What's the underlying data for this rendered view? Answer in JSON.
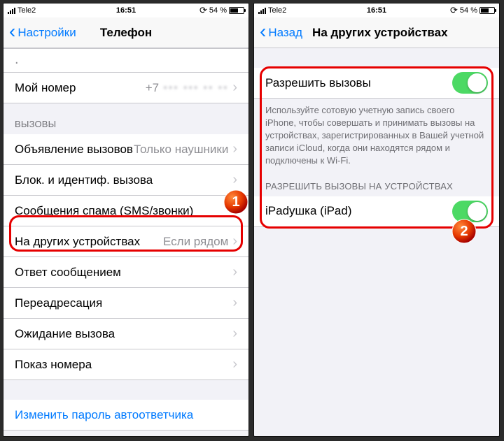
{
  "status": {
    "carrier": "Tele2",
    "time": "16:51",
    "battery_pct": "54 %"
  },
  "left": {
    "back": "Настройки",
    "title": "Телефон",
    "my_number_label": "Мой номер",
    "my_number_value": "+7",
    "section_calls": "ВЫЗОВЫ",
    "announce_label": "Объявление вызовов",
    "announce_detail": "Только наушники",
    "block_label": "Блок. и идентиф. вызова",
    "spam_label": "Сообщения спама (SMS/звонки)",
    "other_devices_label": "На других устройствах",
    "other_devices_detail": "Если рядом",
    "reply_msg_label": "Ответ сообщением",
    "forward_label": "Переадресация",
    "call_waiting_label": "Ожидание вызова",
    "caller_id_label": "Показ номера",
    "vm_password_label": "Изменить пароль автоответчика"
  },
  "right": {
    "back": "Назад",
    "title": "На других устройствах",
    "allow_label": "Разрешить вызовы",
    "allow_footer": "Используйте сотовую учетную запись своего iPhone, чтобы совершать и принимать вызовы на устройствах, зарегистрированных в Вашей учетной записи iCloud, когда они находятся рядом и подключены к Wi-Fi.",
    "devices_header": "РАЗРЕШИТЬ ВЫЗОВЫ НА УСТРОЙСТВАХ",
    "device1_label": "iPadушка (iPad)"
  },
  "markers": {
    "one": "1",
    "two": "2"
  }
}
